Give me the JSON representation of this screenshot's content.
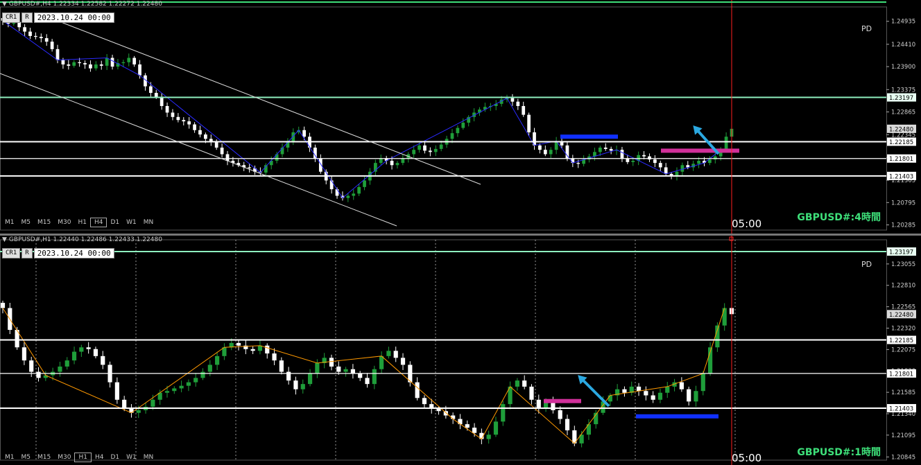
{
  "top": {
    "header": "GBPUSD#,H4  1.22334 1.22582 1.22272 1.22480",
    "buttons": [
      "CR1",
      "R"
    ],
    "date": "2023.10.24 00:00",
    "timeframes": [
      "M1",
      "M5",
      "M15",
      "M30",
      "H1",
      "H4",
      "D1",
      "W1",
      "MN"
    ],
    "active_tf": "H4",
    "pd": "PD",
    "time_label": "05:00",
    "tf_label": "GBPUSD#:4時間",
    "axis_ticks": [
      "1.24935",
      "1.24410",
      "1.23900",
      "1.23375",
      "1.22865",
      "1.22345",
      "1.21825",
      "1.21305",
      "1.20795",
      "1.20285"
    ],
    "level_tags": [
      "1.23197",
      "1.22480",
      "1.22185",
      "1.21801",
      "1.21403"
    ]
  },
  "bottom": {
    "header": "GBPUSD#,H1  1.22440 1.22486 1.22433 1.22480",
    "buttons": [
      "CR1",
      "R"
    ],
    "date": "2023.10.24 00:00",
    "timeframes": [
      "M1",
      "M5",
      "M15",
      "M30",
      "H1",
      "H4",
      "D1",
      "W1",
      "MN"
    ],
    "active_tf": "H1",
    "pd": "PD",
    "time_label": "05:00",
    "tf_label": "GBPUSD#:1時間",
    "axis_ticks": [
      "1.23055",
      "1.22810",
      "1.22565",
      "1.22320",
      "1.22075",
      "1.21830",
      "1.21585",
      "1.21340",
      "1.21095",
      "1.20845"
    ],
    "level_tags": [
      "1.23197",
      "1.22480",
      "1.22185",
      "1.21801",
      "1.21403"
    ]
  },
  "colors": {
    "background": "#000000",
    "candle_up": "#1f9e3a",
    "candle_down": "#ffffff",
    "level_line": "#ffffff",
    "resistance_line": "#8ff0c0",
    "zigzag_top": "#2a2aff",
    "zigzag_bottom": "#ff9900",
    "blue_bar": "#1030ff",
    "magenta_bar": "#d0309a",
    "arrow": "#2ba8e0",
    "cursor_line": "#ff2020",
    "tf_label": "#3ee07a"
  },
  "chart_data": [
    {
      "type": "candlestick",
      "title": "GBPUSD#,H4",
      "ylim": [
        1.2023,
        1.252
      ],
      "levels": [
        1.23197,
        1.22185,
        1.21801,
        1.21403
      ],
      "last_price": 1.2248,
      "closes": [
        1.2495,
        1.2488,
        1.2492,
        1.248,
        1.247,
        1.246,
        1.2458,
        1.2455,
        1.2447,
        1.243,
        1.2405,
        1.2395,
        1.2392,
        1.24,
        1.2398,
        1.2395,
        1.2386,
        1.2395,
        1.2392,
        1.241,
        1.239,
        1.2398,
        1.24,
        1.241,
        1.2395,
        1.237,
        1.2345,
        1.233,
        1.232,
        1.23,
        1.2285,
        1.2275,
        1.2268,
        1.2265,
        1.2258,
        1.2245,
        1.2235,
        1.2225,
        1.2218,
        1.2205,
        1.219,
        1.2175,
        1.217,
        1.2165,
        1.216,
        1.2158,
        1.215,
        1.2148,
        1.2165,
        1.2175,
        1.219,
        1.2205,
        1.222,
        1.224,
        1.2245,
        1.223,
        1.2205,
        1.218,
        1.215,
        1.213,
        1.211,
        1.2095,
        1.209,
        1.2095,
        1.21,
        1.2115,
        1.213,
        1.215,
        1.217,
        1.218,
        1.2175,
        1.2165,
        1.217,
        1.218,
        1.219,
        1.22,
        1.221,
        1.2198,
        1.2195,
        1.2202,
        1.2212,
        1.2225,
        1.2238,
        1.225,
        1.2262,
        1.2275,
        1.2285,
        1.2292,
        1.2298,
        1.23,
        1.2305,
        1.2315,
        1.2318,
        1.231,
        1.23,
        1.228,
        1.224,
        1.221,
        1.22,
        1.219,
        1.22,
        1.222,
        1.221,
        1.218,
        1.217,
        1.2168,
        1.2178,
        1.2185,
        1.2195,
        1.2205,
        1.2202,
        1.2198,
        1.22,
        1.218,
        1.2172,
        1.2175,
        1.2188,
        1.2185,
        1.2178,
        1.217,
        1.216,
        1.2145,
        1.214,
        1.215,
        1.2165,
        1.216,
        1.2168,
        1.2175,
        1.217,
        1.2178,
        1.2185,
        1.22,
        1.223,
        1.2248
      ]
    },
    {
      "type": "candlestick",
      "title": "GBPUSD#,H1",
      "ylim": [
        1.2084,
        1.233
      ],
      "levels": [
        1.23197,
        1.22185,
        1.21801,
        1.21403
      ],
      "last_price": 1.2248,
      "closes": [
        1.2255,
        1.223,
        1.221,
        1.2195,
        1.2182,
        1.2175,
        1.2178,
        1.2182,
        1.2188,
        1.2195,
        1.2205,
        1.221,
        1.2208,
        1.22,
        1.219,
        1.217,
        1.215,
        1.214,
        1.2135,
        1.2138,
        1.2142,
        1.215,
        1.2158,
        1.216,
        1.2163,
        1.2166,
        1.217,
        1.2175,
        1.2182,
        1.219,
        1.22,
        1.221,
        1.2215,
        1.2212,
        1.2208,
        1.2206,
        1.2212,
        1.2203,
        1.2195,
        1.2182,
        1.2172,
        1.2162,
        1.2168,
        1.218,
        1.2192,
        1.2198,
        1.2188,
        1.2182,
        1.2185,
        1.218,
        1.2175,
        1.2168,
        1.2185,
        1.22,
        1.2206,
        1.2198,
        1.219,
        1.217,
        1.2152,
        1.2145,
        1.214,
        1.2137,
        1.2132,
        1.2128,
        1.2122,
        1.2118,
        1.2112,
        1.2105,
        1.211,
        1.2125,
        1.2145,
        1.2165,
        1.2172,
        1.2165,
        1.215,
        1.214,
        1.2148,
        1.2138,
        1.2128,
        1.2115,
        1.21,
        1.211,
        1.2122,
        1.2135,
        1.2148,
        1.2155,
        1.2162,
        1.2158,
        1.2165,
        1.216,
        1.2155,
        1.215,
        1.2158,
        1.2165,
        1.217,
        1.2162,
        1.2148,
        1.216,
        1.218,
        1.221,
        1.2235,
        1.2255,
        1.2248
      ]
    }
  ]
}
